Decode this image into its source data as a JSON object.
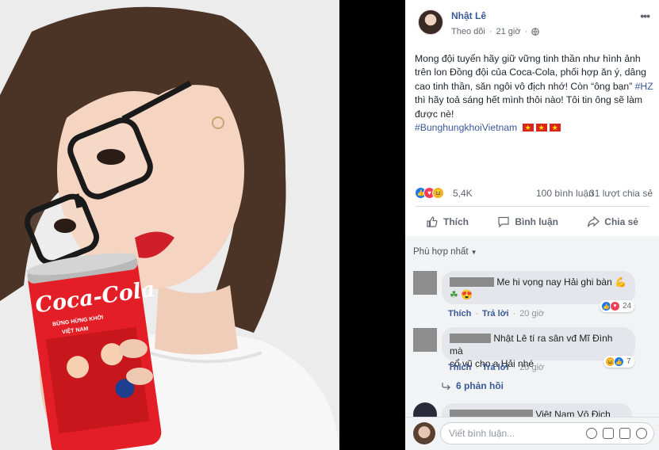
{
  "post": {
    "author": "Nhật Lê",
    "follow": "Theo dõi",
    "time": "21 giờ",
    "text_main": "Mong đội tuyển hãy giữ vững tinh thần như hình ảnh trên lon Đồng đội của Coca-Cola, phối hợp ăn ý, dâng cao tinh thần, săn ngôi vô địch nhớ! Còn “ông bạn” ",
    "hashtag_hz": "#HZ",
    "text_tail": " thì hãy toả sáng hết mình thôi nào! Tôi tin ông sẽ làm được nè!",
    "hashtag_main": "#BunghungkhoiVietnam"
  },
  "photo": {
    "can_brand": "Coca-Cola",
    "can_line1": "BỪNG HỪNG KHỞI",
    "can_line2": "VIỆT NAM"
  },
  "stats": {
    "reactions": "5,4K",
    "comments": "100 bình luận",
    "shares": "31 lượt chia sẻ"
  },
  "actions": {
    "like": "Thích",
    "comment": "Bình luận",
    "share": "Chia sẻ"
  },
  "sort_label": "Phù hợp nhất",
  "comments": [
    {
      "text": "Me hi vọng nay Hải ghi bàn",
      "like": "Thích",
      "reply": "Trả lời",
      "time": "20 giờ",
      "count": "24"
    },
    {
      "text_line1": "Nhật Lê tí ra sân vđ Mĩ Đình mà",
      "text_line2": "cổ vũ cho a Hải nhé",
      "like": "Thích",
      "reply": "Trả lời",
      "time": "20 giờ",
      "count": "7"
    },
    {
      "text": "Việt Nam Vô Địch"
    }
  ],
  "replies_label": "6 phản hồi",
  "comment_input_placeholder": "Viết bình luận...",
  "colors": {
    "link_blue": "#385898",
    "like_blue": "#1877f2",
    "coke_red": "#e41e26"
  }
}
